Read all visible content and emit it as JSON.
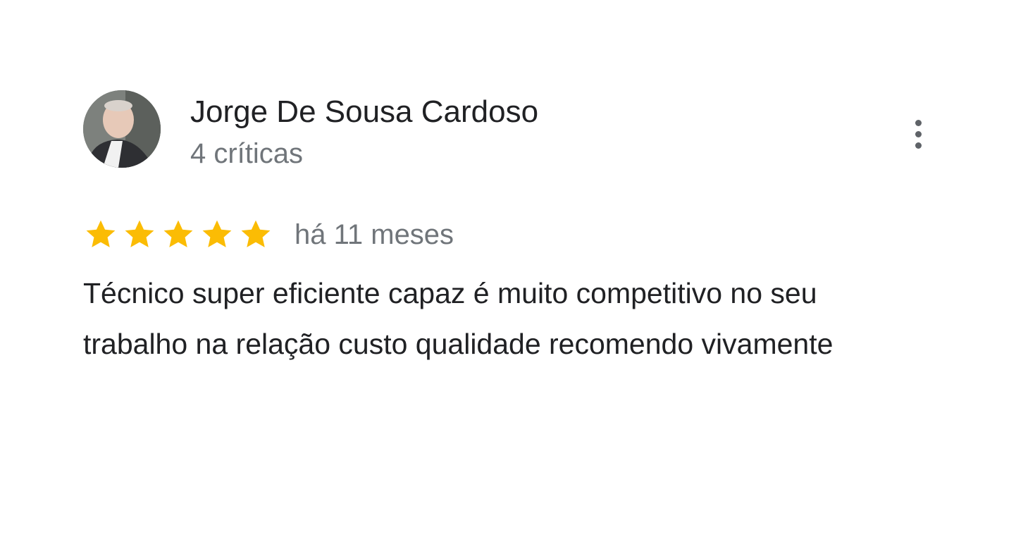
{
  "review": {
    "author_name": "Jorge De Sousa Cardoso",
    "author_meta": "4 críticas",
    "avatar_icon": "user-photo-avatar",
    "more_icon": "more-vert-icon",
    "rating": 5,
    "rating_max": 5,
    "star_color": "#fbbc04",
    "date": "há 11 meses",
    "text": "Técnico super eficiente capaz é muito competitivo no seu trabalho na relação custo qualidade recomendo vivamente"
  }
}
